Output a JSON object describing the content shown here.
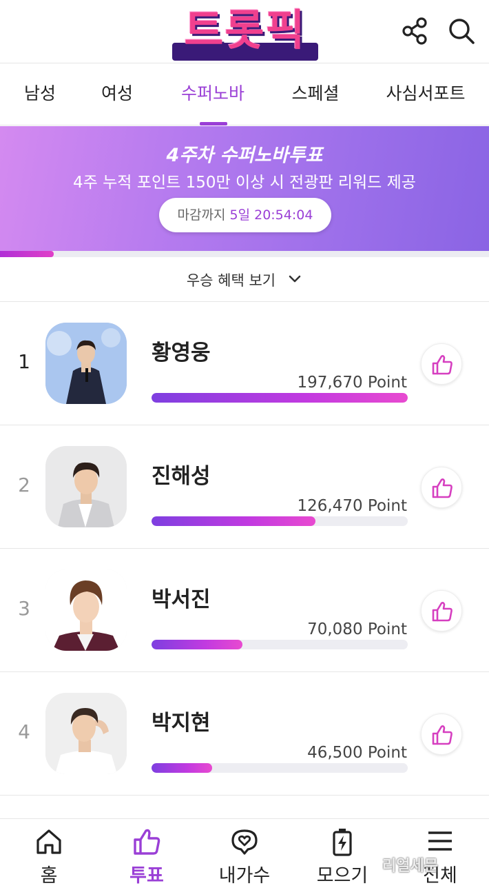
{
  "header": {
    "logo_text": "트롯픽"
  },
  "tabs": [
    {
      "label": "남성",
      "active": false
    },
    {
      "label": "여성",
      "active": false
    },
    {
      "label": "수퍼노바",
      "active": true
    },
    {
      "label": "스페셜",
      "active": false
    },
    {
      "label": "사심서포트",
      "active": false
    }
  ],
  "banner": {
    "title": "4주차 수퍼노바투표",
    "subtitle": "4주 누적 포인트 150만 이상 시 전광판 리워드 제공",
    "deadline_label": "마감까지",
    "deadline_time": "5일 20:54:04",
    "progress_fraction": 0.11
  },
  "benefits": {
    "label": "우승 혜택 보기"
  },
  "ranking": [
    {
      "rank": "1",
      "name": "황영웅",
      "points": "197,670 Point",
      "value": 197670
    },
    {
      "rank": "2",
      "name": "진해성",
      "points": "126,470 Point",
      "value": 126470
    },
    {
      "rank": "3",
      "name": "박서진",
      "points": "70,080 Point",
      "value": 70080
    },
    {
      "rank": "4",
      "name": "박지현",
      "points": "46,500 Point",
      "value": 46500
    }
  ],
  "bottom_nav": [
    {
      "label": "홈",
      "icon": "home-icon",
      "active": false
    },
    {
      "label": "투표",
      "icon": "thumbs-up-icon",
      "active": true
    },
    {
      "label": "내가수",
      "icon": "heart-chat-icon",
      "active": false
    },
    {
      "label": "모으기",
      "icon": "battery-charge-icon",
      "active": false
    },
    {
      "label": "전체",
      "icon": "menu-icon",
      "active": false
    }
  ],
  "watermark": "리얼세문",
  "colors": {
    "accent": "#9a3fd6",
    "bar_start": "#7e3fe0",
    "bar_end": "#e84ad0",
    "banner_start": "#d48af0",
    "banner_end": "#8a64e4"
  }
}
